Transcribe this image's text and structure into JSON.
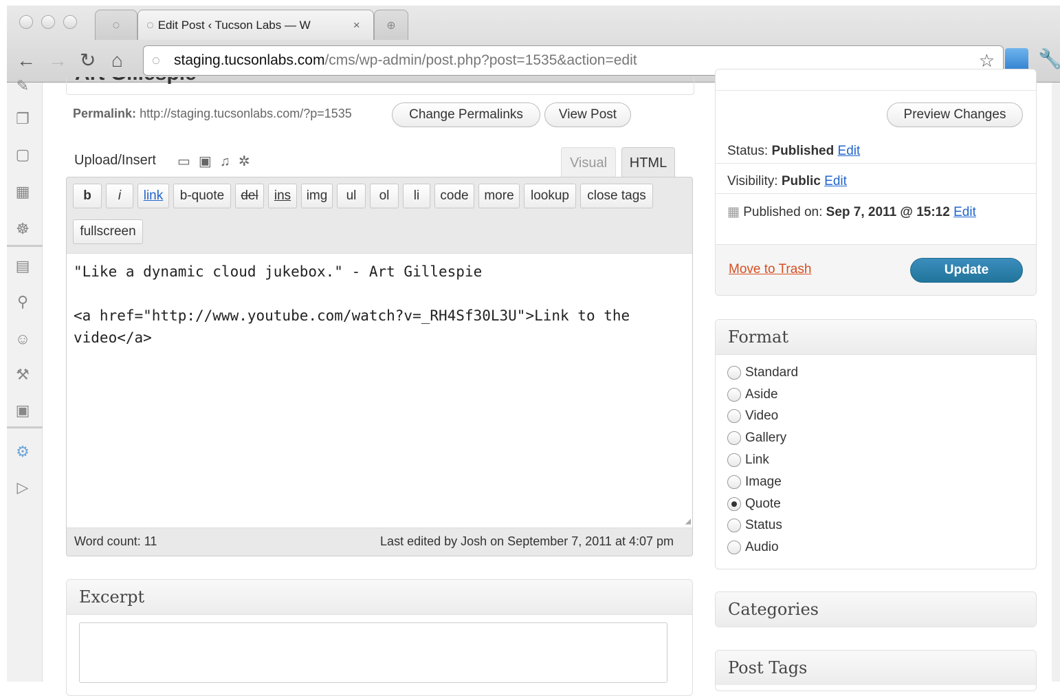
{
  "browser": {
    "tabs": [
      {
        "title": "Edit Post ‹ Tucson Labs — W"
      }
    ],
    "close_glyph": "×",
    "url_host": "staging.tucsonlabs.com",
    "url_path": "/cms/wp-admin/post.php?post=1535&action=edit"
  },
  "post": {
    "title_fragment": "Art Gillespie",
    "permalink_label": "Permalink:",
    "permalink_url": "http://staging.tucsonlabs.com/?p=1535",
    "change_permalinks_label": "Change Permalinks",
    "view_post_label": "View Post"
  },
  "editor": {
    "upload_insert_label": "Upload/Insert",
    "tab_visual": "Visual",
    "tab_html": "HTML",
    "quicktags": [
      "b",
      "i",
      "link",
      "b-quote",
      "del",
      "ins",
      "img",
      "ul",
      "ol",
      "li",
      "code",
      "more",
      "lookup",
      "close tags"
    ],
    "fullscreen_label": "fullscreen",
    "content_line1": "\"Like a dynamic cloud jukebox.\" - Art Gillespie",
    "content_line2": "<a href=\"http://www.youtube.com/watch?v=_RH4Sf30L3U\">Link to the",
    "content_line3": "video</a>",
    "word_count": "Word count: 11",
    "last_edited": "Last edited by Josh on September 7, 2011 at 4:07 pm"
  },
  "excerpt": {
    "title": "Excerpt"
  },
  "publish": {
    "preview_label": "Preview Changes",
    "status_label": "Status:",
    "status_value": "Published",
    "visibility_label": "Visibility:",
    "visibility_value": "Public",
    "published_on_label": "Published on:",
    "published_on_value": "Sep 7, 2011 @ 15:12",
    "edit_label": "Edit",
    "trash_label": "Move to Trash",
    "update_label": "Update"
  },
  "format": {
    "title": "Format",
    "options": [
      "Standard",
      "Aside",
      "Video",
      "Gallery",
      "Link",
      "Image",
      "Quote",
      "Status",
      "Audio"
    ],
    "selected": "Quote"
  },
  "categories": {
    "title": "Categories"
  },
  "post_tags": {
    "title": "Post Tags"
  },
  "colors": {
    "accent": "#21759b",
    "link": "#2266cc",
    "trash": "#d54e21"
  }
}
